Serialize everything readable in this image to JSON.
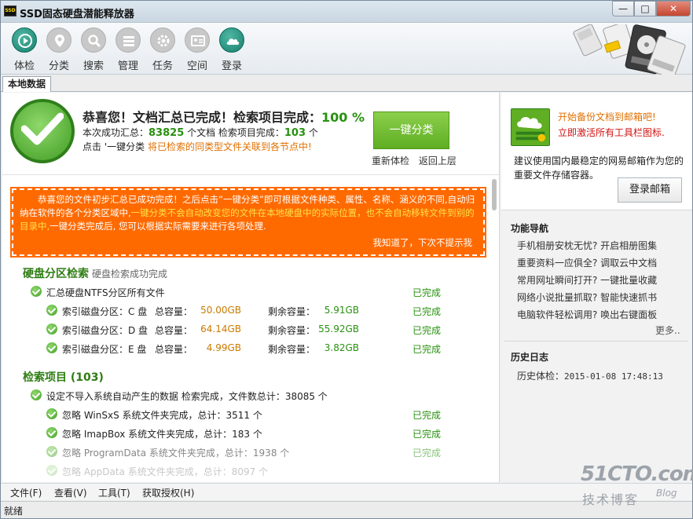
{
  "window": {
    "title": "SSD固态硬盘潜能释放器",
    "icon_label": "SSD",
    "controls": {
      "minimize": "—",
      "maximize": "□",
      "close": "✕"
    }
  },
  "toolbar": {
    "items": [
      {
        "label": "体检",
        "icon": "play-icon",
        "active": true
      },
      {
        "label": "分类",
        "icon": "location-pin-icon",
        "active": false
      },
      {
        "label": "搜索",
        "icon": "search-icon",
        "active": false
      },
      {
        "label": "管理",
        "icon": "list-icon",
        "active": false
      },
      {
        "label": "任务",
        "icon": "gear-icon",
        "active": false
      },
      {
        "label": "空间",
        "icon": "id-card-icon",
        "active": false
      },
      {
        "label": "登录",
        "icon": "cloud-icon",
        "active": true
      }
    ]
  },
  "tab": {
    "label": "本地数据"
  },
  "summary": {
    "headline": "恭喜您！文档汇总已完成！检索项目完成：",
    "percent": "100 %",
    "l2_prefix": "本次成功汇总：",
    "doc_count": "83825",
    "l2_docs": " 个文档  检索项目完成：",
    "item_count": "103",
    "l2_items": " 个",
    "l3_prefix": "点击 '一键分类 ",
    "l3_hint": "将已检索的同类型文件关联到各节点中!",
    "classify_button": "一键分类",
    "recheck_link": "重新体检",
    "back_link": "返回上层"
  },
  "notice": {
    "body_a": "恭喜您的文件初步汇总已成功完成！之后点击“一键分类”即可根据文件种类、属性、名称、涵义的不同,自动归纳在软件的各个分类区域中,",
    "body_hl": "一键分类不会自动改变您的文件在本地硬盘中的实际位置，也不会自动移转文件到别的目录中,",
    "body_b": "一键分类完成后, 您可以根据实际需要来进行各项处理.",
    "dismiss": "我知道了，下次不提示我"
  },
  "disk_section": {
    "title": "硬盘分区检索",
    "subtitle": "硬盘检索成功完成",
    "summary_row": {
      "text": "汇总硬盘NTFS分区所有文件",
      "status": "已完成"
    },
    "partitions": [
      {
        "label": "索引磁盘分区：C 盘",
        "total_label": "总容量：",
        "total": "50.00GB",
        "free_label": "剩余容量：",
        "free": "5.91GB",
        "status": "已完成"
      },
      {
        "label": "索引磁盘分区：D 盘",
        "total_label": "总容量：",
        "total": "64.14GB",
        "free_label": "剩余容量：",
        "free": "55.92GB",
        "status": "已完成"
      },
      {
        "label": "索引磁盘分区：E 盘",
        "total_label": "总容量：",
        "total": "4.99GB",
        "free_label": "剩余容量：",
        "free": "3.82GB",
        "status": "已完成"
      }
    ]
  },
  "items_section": {
    "title": "检索项目 (103)",
    "summary_row": {
      "text": "设定不导入系统自动产生的数据 检索完成，文件数总计：38085 个"
    },
    "rows": [
      {
        "text": "忽略 WinSxS 系统文件夹完成，总计：3511 个",
        "status": "已完成"
      },
      {
        "text": "忽略 ImapBox 系统文件夹完成，总计：183 个",
        "status": "已完成"
      },
      {
        "text": "忽略 ProgramData 系统文件夹完成，总计：1938 个",
        "status": "已完成"
      },
      {
        "text": "忽略 AppData 系统文件夹完成，总计：8097 个",
        "status": ""
      }
    ]
  },
  "promo": {
    "line1": "开始备份文档到邮箱吧!",
    "line2": "立即激活所有工具栏图标.",
    "desc": "建议使用国内最稳定的网易邮箱作为您的重要文件存储容器。",
    "login_button": "登录邮箱"
  },
  "nav": {
    "title": "功能导航",
    "items": [
      "手机相册安枕无忧?  开启相册图集",
      "重要资料一应俱全?  调取云中文档",
      "常用网址瞬间打开?  一键批量收藏",
      "网络小说批量抓取?  智能快速抓书",
      "电脑软件轻松调用?  唤出右键面板"
    ],
    "more": "更多.."
  },
  "history": {
    "title": "历史日志",
    "label": "历史体检：",
    "time": "2015-01-08 17:48:13"
  },
  "menubar": {
    "items": [
      "文件(F)",
      "查看(V)",
      "工具(T)",
      "获取授权(H)"
    ]
  },
  "status": {
    "text": "就绪"
  },
  "watermark": {
    "brand": "51CTO.com",
    "cn": "技术博客",
    "blog": "Blog"
  },
  "colors": {
    "accent_green": "#27910f",
    "notice_orange": "#ff6a00",
    "toolbar_teal": "#17806d"
  }
}
